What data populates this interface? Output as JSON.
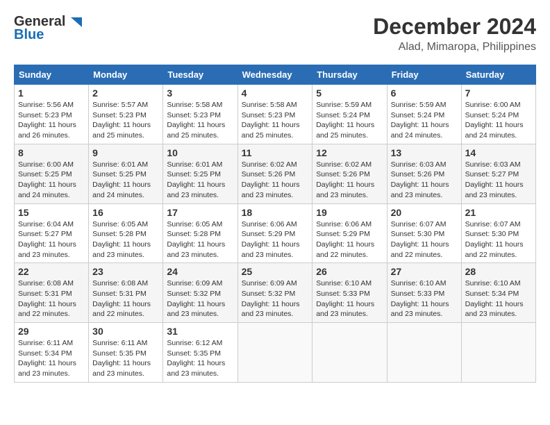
{
  "header": {
    "logo_line1": "General",
    "logo_line2": "Blue",
    "month": "December 2024",
    "location": "Alad, Mimaropa, Philippines"
  },
  "weekdays": [
    "Sunday",
    "Monday",
    "Tuesday",
    "Wednesday",
    "Thursday",
    "Friday",
    "Saturday"
  ],
  "weeks": [
    [
      {
        "day": "1",
        "info": "Sunrise: 5:56 AM\nSunset: 5:23 PM\nDaylight: 11 hours and 26 minutes."
      },
      {
        "day": "2",
        "info": "Sunrise: 5:57 AM\nSunset: 5:23 PM\nDaylight: 11 hours and 25 minutes."
      },
      {
        "day": "3",
        "info": "Sunrise: 5:58 AM\nSunset: 5:23 PM\nDaylight: 11 hours and 25 minutes."
      },
      {
        "day": "4",
        "info": "Sunrise: 5:58 AM\nSunset: 5:23 PM\nDaylight: 11 hours and 25 minutes."
      },
      {
        "day": "5",
        "info": "Sunrise: 5:59 AM\nSunset: 5:24 PM\nDaylight: 11 hours and 25 minutes."
      },
      {
        "day": "6",
        "info": "Sunrise: 5:59 AM\nSunset: 5:24 PM\nDaylight: 11 hours and 24 minutes."
      },
      {
        "day": "7",
        "info": "Sunrise: 6:00 AM\nSunset: 5:24 PM\nDaylight: 11 hours and 24 minutes."
      }
    ],
    [
      {
        "day": "8",
        "info": "Sunrise: 6:00 AM\nSunset: 5:25 PM\nDaylight: 11 hours and 24 minutes."
      },
      {
        "day": "9",
        "info": "Sunrise: 6:01 AM\nSunset: 5:25 PM\nDaylight: 11 hours and 24 minutes."
      },
      {
        "day": "10",
        "info": "Sunrise: 6:01 AM\nSunset: 5:25 PM\nDaylight: 11 hours and 23 minutes."
      },
      {
        "day": "11",
        "info": "Sunrise: 6:02 AM\nSunset: 5:26 PM\nDaylight: 11 hours and 23 minutes."
      },
      {
        "day": "12",
        "info": "Sunrise: 6:02 AM\nSunset: 5:26 PM\nDaylight: 11 hours and 23 minutes."
      },
      {
        "day": "13",
        "info": "Sunrise: 6:03 AM\nSunset: 5:26 PM\nDaylight: 11 hours and 23 minutes."
      },
      {
        "day": "14",
        "info": "Sunrise: 6:03 AM\nSunset: 5:27 PM\nDaylight: 11 hours and 23 minutes."
      }
    ],
    [
      {
        "day": "15",
        "info": "Sunrise: 6:04 AM\nSunset: 5:27 PM\nDaylight: 11 hours and 23 minutes."
      },
      {
        "day": "16",
        "info": "Sunrise: 6:05 AM\nSunset: 5:28 PM\nDaylight: 11 hours and 23 minutes."
      },
      {
        "day": "17",
        "info": "Sunrise: 6:05 AM\nSunset: 5:28 PM\nDaylight: 11 hours and 23 minutes."
      },
      {
        "day": "18",
        "info": "Sunrise: 6:06 AM\nSunset: 5:29 PM\nDaylight: 11 hours and 23 minutes."
      },
      {
        "day": "19",
        "info": "Sunrise: 6:06 AM\nSunset: 5:29 PM\nDaylight: 11 hours and 22 minutes."
      },
      {
        "day": "20",
        "info": "Sunrise: 6:07 AM\nSunset: 5:30 PM\nDaylight: 11 hours and 22 minutes."
      },
      {
        "day": "21",
        "info": "Sunrise: 6:07 AM\nSunset: 5:30 PM\nDaylight: 11 hours and 22 minutes."
      }
    ],
    [
      {
        "day": "22",
        "info": "Sunrise: 6:08 AM\nSunset: 5:31 PM\nDaylight: 11 hours and 22 minutes."
      },
      {
        "day": "23",
        "info": "Sunrise: 6:08 AM\nSunset: 5:31 PM\nDaylight: 11 hours and 22 minutes."
      },
      {
        "day": "24",
        "info": "Sunrise: 6:09 AM\nSunset: 5:32 PM\nDaylight: 11 hours and 23 minutes."
      },
      {
        "day": "25",
        "info": "Sunrise: 6:09 AM\nSunset: 5:32 PM\nDaylight: 11 hours and 23 minutes."
      },
      {
        "day": "26",
        "info": "Sunrise: 6:10 AM\nSunset: 5:33 PM\nDaylight: 11 hours and 23 minutes."
      },
      {
        "day": "27",
        "info": "Sunrise: 6:10 AM\nSunset: 5:33 PM\nDaylight: 11 hours and 23 minutes."
      },
      {
        "day": "28",
        "info": "Sunrise: 6:10 AM\nSunset: 5:34 PM\nDaylight: 11 hours and 23 minutes."
      }
    ],
    [
      {
        "day": "29",
        "info": "Sunrise: 6:11 AM\nSunset: 5:34 PM\nDaylight: 11 hours and 23 minutes."
      },
      {
        "day": "30",
        "info": "Sunrise: 6:11 AM\nSunset: 5:35 PM\nDaylight: 11 hours and 23 minutes."
      },
      {
        "day": "31",
        "info": "Sunrise: 6:12 AM\nSunset: 5:35 PM\nDaylight: 11 hours and 23 minutes."
      },
      {
        "day": "",
        "info": ""
      },
      {
        "day": "",
        "info": ""
      },
      {
        "day": "",
        "info": ""
      },
      {
        "day": "",
        "info": ""
      }
    ]
  ]
}
